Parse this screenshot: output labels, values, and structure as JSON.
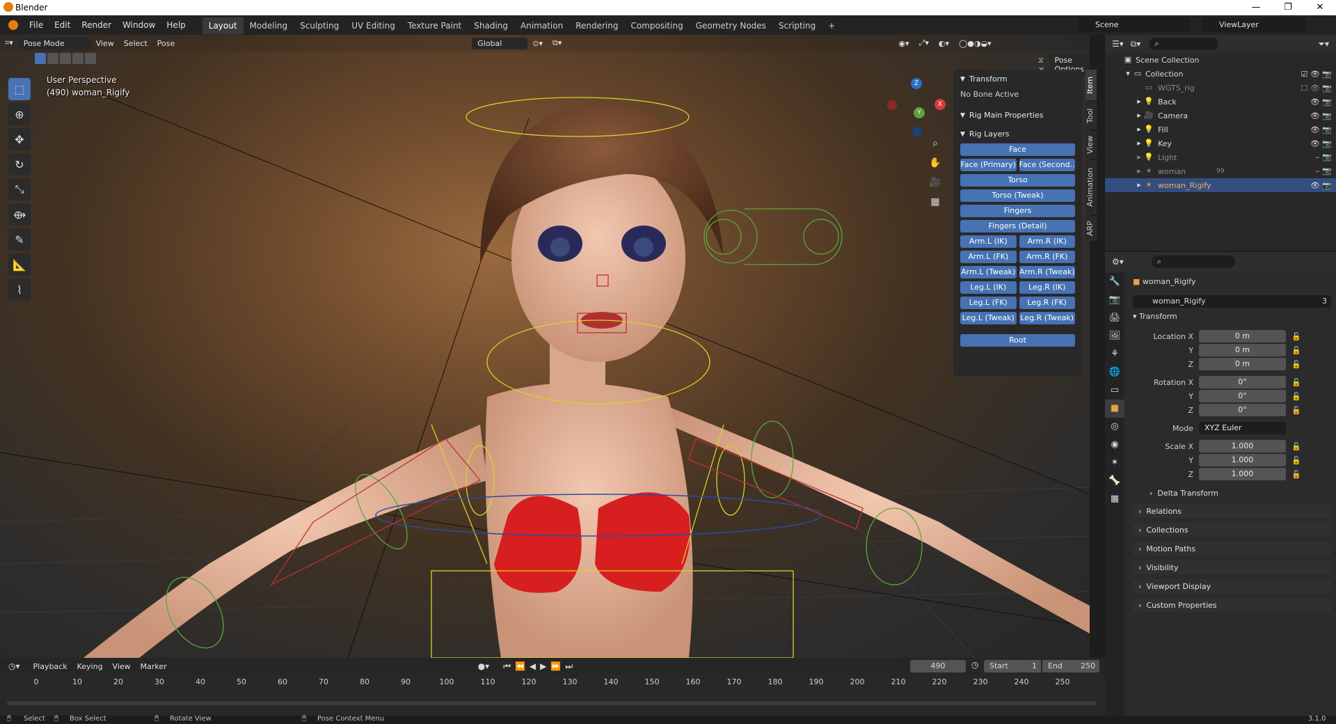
{
  "app": {
    "title": "Blender",
    "version": "3.1.0"
  },
  "window_controls": {
    "minimize": "—",
    "maximize": "❐",
    "close": "✕"
  },
  "menu": [
    "File",
    "Edit",
    "Render",
    "Window",
    "Help"
  ],
  "workspaces": [
    "Layout",
    "Modeling",
    "Sculpting",
    "UV Editing",
    "Texture Paint",
    "Shading",
    "Animation",
    "Rendering",
    "Compositing",
    "Geometry Nodes",
    "Scripting"
  ],
  "workspace_add": "+",
  "active_workspace": "Layout",
  "scene": "Scene",
  "view_layer": "ViewLayer",
  "viewport": {
    "mode": "Pose Mode",
    "menus": [
      "View",
      "Select",
      "Pose"
    ],
    "orientation": "Global",
    "pose_options": "Pose Options",
    "perspective": "User Perspective",
    "object_info": "(490) woman_Rigify",
    "gizmo": {
      "x": "X",
      "y": "Y",
      "z": "Z"
    }
  },
  "npanel": {
    "transform_title": "Transform",
    "no_bone": "No Bone Active",
    "rig_main": "Rig Main Properties",
    "rig_layers_title": "Rig Layers",
    "layers": [
      [
        "Face"
      ],
      [
        "Face (Primary)",
        "Face (Second..."
      ],
      [
        "Torso"
      ],
      [
        "Torso (Tweak)"
      ],
      [
        "Fingers"
      ],
      [
        "Fingers (Detail)"
      ],
      [
        "Arm.L (IK)",
        "Arm.R (IK)"
      ],
      [
        "Arm.L (FK)",
        "Arm.R (FK)"
      ],
      [
        "Arm.L (Tweak)",
        "Arm.R (Tweak)"
      ],
      [
        "Leg.L (IK)",
        "Leg.R (IK)"
      ],
      [
        "Leg.L (FK)",
        "Leg.R (FK)"
      ],
      [
        "Leg.L (Tweak)",
        "Leg.R (Tweak)"
      ]
    ],
    "root": "Root",
    "tabs": [
      "Item",
      "Tool",
      "View",
      "Animation",
      "ARP"
    ]
  },
  "outliner": {
    "scene_collection": "Scene Collection",
    "collection": "Collection",
    "items": [
      {
        "name": "WGTS_rig",
        "dim": true
      },
      {
        "name": "Back",
        "dim": false
      },
      {
        "name": "Camera",
        "dim": false
      },
      {
        "name": "Fill",
        "dim": false
      },
      {
        "name": "Key",
        "dim": false
      },
      {
        "name": "Light",
        "dim": true
      },
      {
        "name": "woman",
        "dim": true,
        "badge": "99"
      },
      {
        "name": "woman_Rigify",
        "dim": false,
        "selected": true
      }
    ]
  },
  "properties": {
    "object_name": "woman_Rigify",
    "data_name": "woman_Rigify",
    "data_users": "3",
    "transform_title": "Transform",
    "location_label": "Location X",
    "rotation_label": "Rotation X",
    "scale_label": "Scale X",
    "axis_y": "Y",
    "axis_z": "Z",
    "location": [
      "0 m",
      "0 m",
      "0 m"
    ],
    "rotation": [
      "0°",
      "0°",
      "0°"
    ],
    "mode_label": "Mode",
    "mode": "XYZ Euler",
    "scale": [
      "1.000",
      "1.000",
      "1.000"
    ],
    "sections": [
      "Delta Transform",
      "Relations",
      "Collections",
      "Motion Paths",
      "Visibility",
      "Viewport Display",
      "Custom Properties"
    ]
  },
  "timeline": {
    "menus": [
      "Playback",
      "Keying",
      "View",
      "Marker"
    ],
    "current_frame": "490",
    "start_label": "Start",
    "start": "1",
    "end_label": "End",
    "end": "250",
    "ticks": [
      "0",
      "10",
      "20",
      "30",
      "40",
      "50",
      "60",
      "70",
      "80",
      "90",
      "100",
      "110",
      "120",
      "130",
      "140",
      "150",
      "160",
      "170",
      "180",
      "190",
      "200",
      "210",
      "220",
      "230",
      "240",
      "250"
    ]
  },
  "status": {
    "select": "Select",
    "box_select": "Box Select",
    "rotate_view": "Rotate View",
    "context_menu": "Pose Context Menu",
    "version": "3.1.0"
  },
  "colors": {
    "accent": "#4772b3",
    "selected_row": "#334d80",
    "panel": "#282828"
  }
}
